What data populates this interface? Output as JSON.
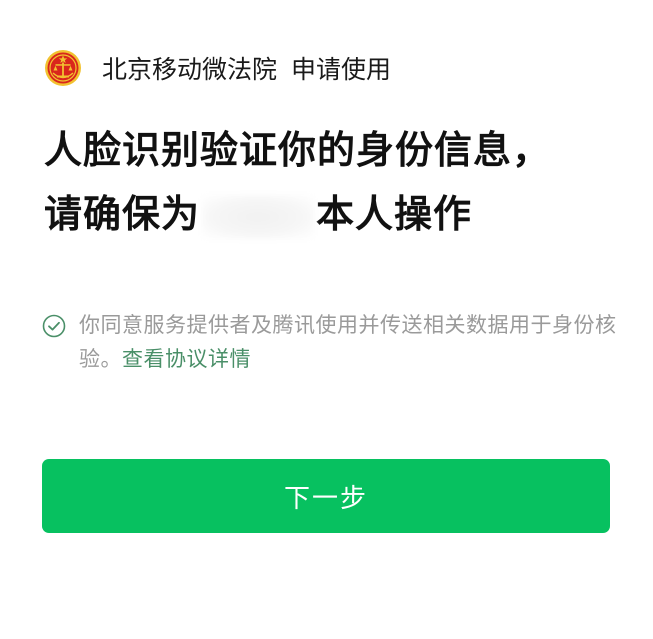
{
  "header": {
    "app_name": "北京移动微法院",
    "action": "申请使用",
    "logo_icon": "court-emblem-icon"
  },
  "title": {
    "line1": "人脸识别验证你的身份信息，",
    "line2_prefix": "请确保为",
    "line2_suffix": "本人操作"
  },
  "consent": {
    "checked": true,
    "check_icon": "check-circle-icon",
    "text": "你同意服务提供者及腾讯使用并传送相关数据用于身份核验。",
    "link_label": "查看协议详情"
  },
  "next_button": {
    "label": "下一步"
  },
  "colors": {
    "primary": "#07c160",
    "link": "#4a8f68",
    "muted_text": "#9a9a9a",
    "logo_red": "#d9261c",
    "logo_gold": "#f2c230"
  }
}
